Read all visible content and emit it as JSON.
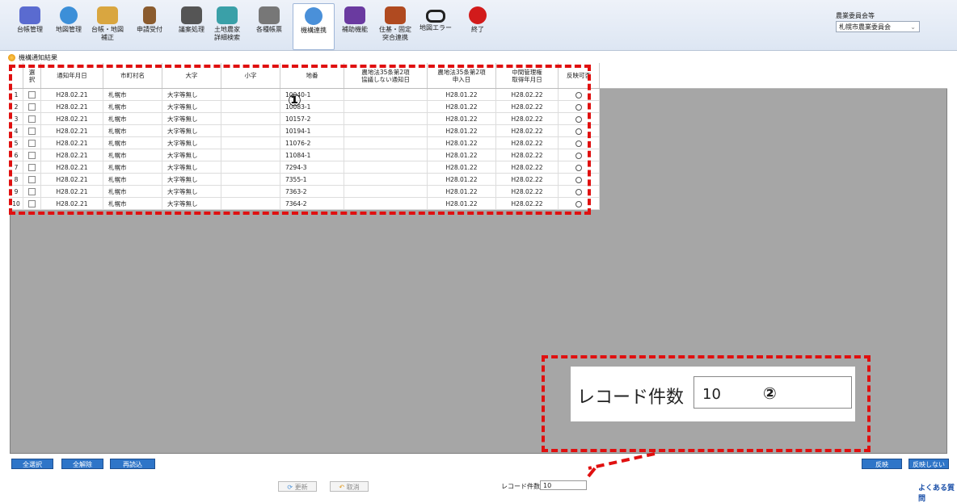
{
  "toolbar": {
    "items": [
      {
        "label": "台帳管理",
        "color": "#5a6bd0"
      },
      {
        "label": "地図管理",
        "color": "#3c8fd8"
      },
      {
        "label": "台帳・地図\n補正",
        "color": "#d9a640"
      },
      {
        "label": "申請受付",
        "color": "#8a5b2e"
      },
      {
        "label": "議案処理",
        "color": "#555555"
      },
      {
        "label": "土地農家\n詳細検索",
        "color": "#3aa0a8"
      },
      {
        "label": "各種帳票",
        "color": "#777777"
      },
      {
        "label": "機構連携",
        "color": "#4a90d9"
      },
      {
        "label": "補助機能",
        "color": "#6a3aa0"
      },
      {
        "label": "住基・固定\n突合連携",
        "color": "#b04a20"
      },
      {
        "label": "地図エラー",
        "color": "#222222"
      },
      {
        "label": "終了",
        "color": "#d21b1b"
      }
    ],
    "active_index": 7
  },
  "committee": {
    "label": "農業委員会等",
    "selected": "札幌市農業委員会"
  },
  "breadcrumb": "機構通知結果",
  "table": {
    "headers": [
      "",
      "選\n択",
      "通知年月日",
      "市町村名",
      "大字",
      "小字",
      "地番",
      "農地法35条第2項\n協議しない通知日",
      "農地法35条第2項\n申入日",
      "中間管理権\n取得年月日",
      "反映可否"
    ],
    "rows": [
      {
        "no": "1",
        "date": "H28.02.21",
        "city": "札幌市",
        "oaza": "大字等無し",
        "koaza": "",
        "chiban": "10040-1",
        "notice": "",
        "apply": "H28.01.22",
        "acquired": "H28.02.22"
      },
      {
        "no": "2",
        "date": "H28.02.21",
        "city": "札幌市",
        "oaza": "大字等無し",
        "koaza": "",
        "chiban": "10083-1",
        "notice": "",
        "apply": "H28.01.22",
        "acquired": "H28.02.22"
      },
      {
        "no": "3",
        "date": "H28.02.21",
        "city": "札幌市",
        "oaza": "大字等無し",
        "koaza": "",
        "chiban": "10157-2",
        "notice": "",
        "apply": "H28.01.22",
        "acquired": "H28.02.22"
      },
      {
        "no": "4",
        "date": "H28.02.21",
        "city": "札幌市",
        "oaza": "大字等無し",
        "koaza": "",
        "chiban": "10194-1",
        "notice": "",
        "apply": "H28.01.22",
        "acquired": "H28.02.22"
      },
      {
        "no": "5",
        "date": "H28.02.21",
        "city": "札幌市",
        "oaza": "大字等無し",
        "koaza": "",
        "chiban": "11076-2",
        "notice": "",
        "apply": "H28.01.22",
        "acquired": "H28.02.22"
      },
      {
        "no": "6",
        "date": "H28.02.21",
        "city": "札幌市",
        "oaza": "大字等無し",
        "koaza": "",
        "chiban": "11084-1",
        "notice": "",
        "apply": "H28.01.22",
        "acquired": "H28.02.22"
      },
      {
        "no": "7",
        "date": "H28.02.21",
        "city": "札幌市",
        "oaza": "大字等無し",
        "koaza": "",
        "chiban": "7294-3",
        "notice": "",
        "apply": "H28.01.22",
        "acquired": "H28.02.22"
      },
      {
        "no": "8",
        "date": "H28.02.21",
        "city": "札幌市",
        "oaza": "大字等無し",
        "koaza": "",
        "chiban": "7355-1",
        "notice": "",
        "apply": "H28.01.22",
        "acquired": "H28.02.22"
      },
      {
        "no": "9",
        "date": "H28.02.21",
        "city": "札幌市",
        "oaza": "大字等無し",
        "koaza": "",
        "chiban": "7363-2",
        "notice": "",
        "apply": "H28.01.22",
        "acquired": "H28.02.22"
      },
      {
        "no": "10",
        "date": "H28.02.21",
        "city": "札幌市",
        "oaza": "大字等無し",
        "koaza": "",
        "chiban": "7364-2",
        "notice": "",
        "apply": "H28.01.22",
        "acquired": "H28.02.22"
      }
    ]
  },
  "annotations": {
    "marker1": "①",
    "marker2": "②"
  },
  "callout": {
    "label": "レコード件数",
    "value": "10"
  },
  "buttons": {
    "select_all": "全選択",
    "clear_all": "全解除",
    "reload": "再読込",
    "reflect": "反映",
    "no_reflect": "反映しない",
    "update": "更新",
    "cancel": "取消"
  },
  "footer": {
    "record_count_label": "レコード件数",
    "record_count_value": "10",
    "logo": "よくある質問"
  },
  "colors": {
    "accent": "#2e75c8",
    "annotation": "#e01010",
    "grid_bg": "#a6a6a6"
  }
}
